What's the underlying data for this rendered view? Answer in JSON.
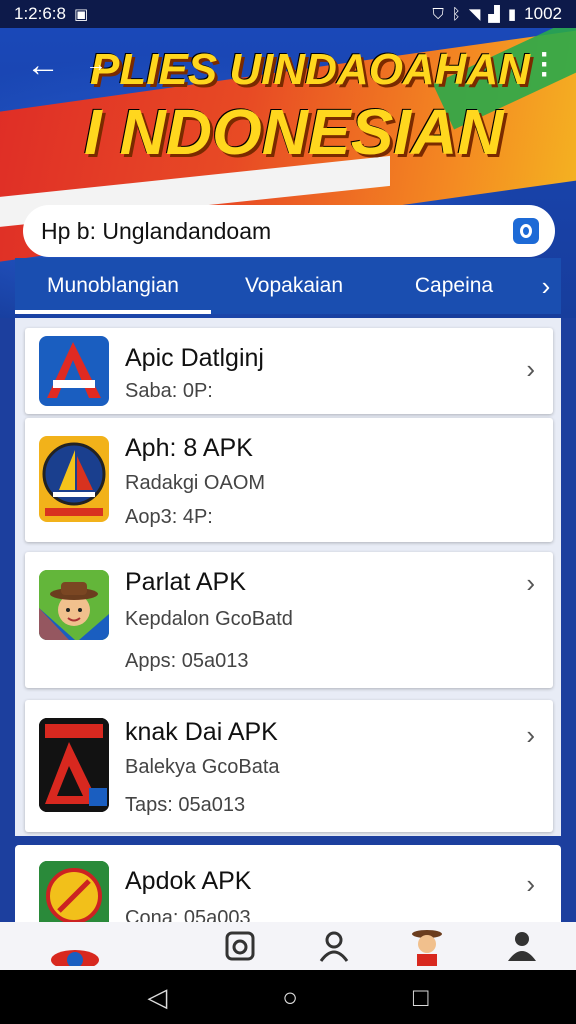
{
  "status_bar": {
    "time": "1:2:6:8",
    "right_text": "1002"
  },
  "header": {
    "title_line1": "PLIES UINDAOAHAN",
    "title_line2": "I NDONESIAN"
  },
  "search": {
    "value": "Hp b: Unglandandoam"
  },
  "tabs": [
    {
      "label": "Munoblangian",
      "active": true
    },
    {
      "label": "Vopakaian",
      "active": false
    },
    {
      "label": "Capeina",
      "active": false
    }
  ],
  "apps": [
    {
      "title": "Apic Datlginj",
      "lines": [
        "Saba: 0P:"
      ],
      "icon": "triangle-app-icon"
    },
    {
      "title": "Aph: 8 APK",
      "lines": [
        "Radakgi OAOM",
        "Aop3: 4P:"
      ],
      "icon": "sailboat-app-icon"
    },
    {
      "title": "Parlat APK",
      "lines": [
        "Kepdalon GcoBatd",
        "Apps: 05a013"
      ],
      "icon": "cowboy-app-icon"
    },
    {
      "title": "knak Dai APK",
      "lines": [
        "Balekya GcoBata",
        "Taps: 05a013"
      ],
      "icon": "red-triangle-app-icon"
    },
    {
      "title": "Apdok APK",
      "lines": [
        "Cona: 05a003"
      ],
      "icon": "badge-app-icon"
    }
  ],
  "colors": {
    "accent": "#1d6ad6",
    "brand_yellow": "#ffd71e",
    "background_blue": "#1c3f9e"
  }
}
